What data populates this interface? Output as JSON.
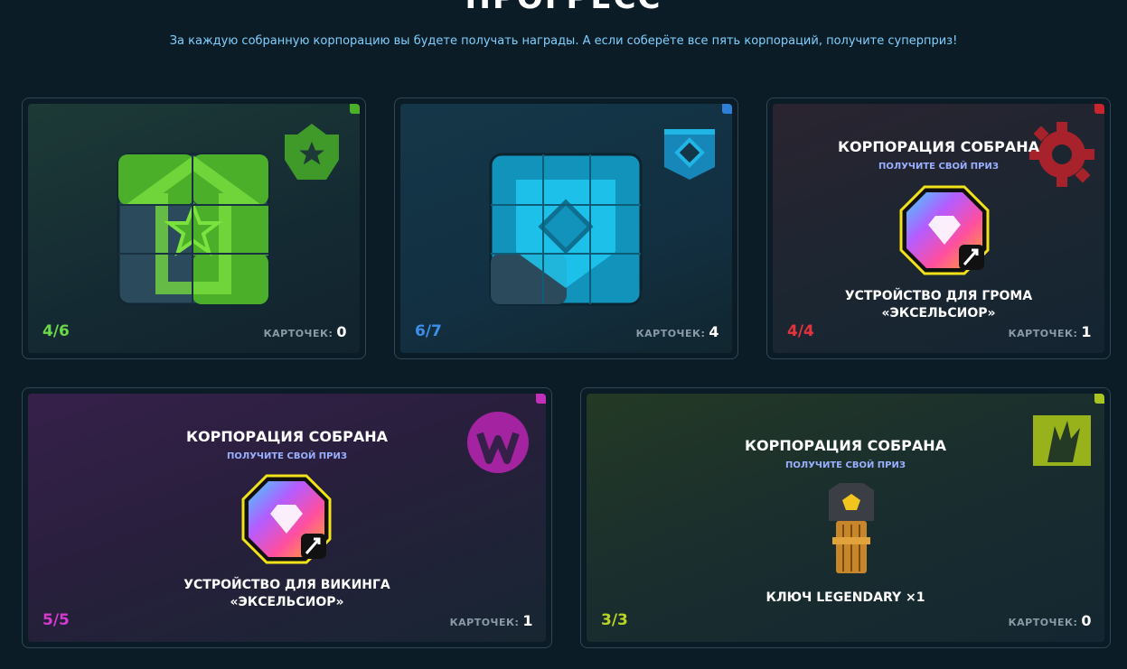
{
  "page": {
    "title": "ПРОГРЕСС",
    "subtitle": "За каждую собранную корпорацию вы будете получать награды. А если соберёте все пять корпораций, получите суперприз!"
  },
  "cards_label": "КАРТОЧЕК:",
  "collected": {
    "title": "КОРПОРАЦИЯ СОБРАНА",
    "subtitle": "ПОЛУЧИТЕ СВОЙ ПРИЗ"
  },
  "corporations": [
    {
      "progress": "4/6",
      "cards": "0",
      "color": "#4caf2a",
      "icon": "star-shield-icon",
      "state": "in-progress"
    },
    {
      "progress": "6/7",
      "cards": "4",
      "color": "#1fb6e6",
      "icon": "diamond-shield-icon",
      "state": "in-progress"
    },
    {
      "progress": "4/4",
      "cards": "1",
      "color": "#c9252f",
      "icon": "gear-icon",
      "state": "collected",
      "prize": [
        "УСТРОЙСТВО ДЛЯ ГРОМА",
        "«ЭКСЕЛЬСИОР»"
      ]
    },
    {
      "progress": "5/5",
      "cards": "1",
      "color": "#c22fb8",
      "icon": "viking-emblem-icon",
      "state": "collected",
      "prize": [
        "УСТРОЙСТВО ДЛЯ ВИКИНГА",
        "«ЭКСЕЛЬСИОР»"
      ]
    },
    {
      "progress": "3/3",
      "cards": "0",
      "color": "#a8c41e",
      "icon": "claw-banner-icon",
      "state": "collected",
      "prize": [
        "КЛЮЧ LEGENDARY ×1"
      ]
    }
  ]
}
